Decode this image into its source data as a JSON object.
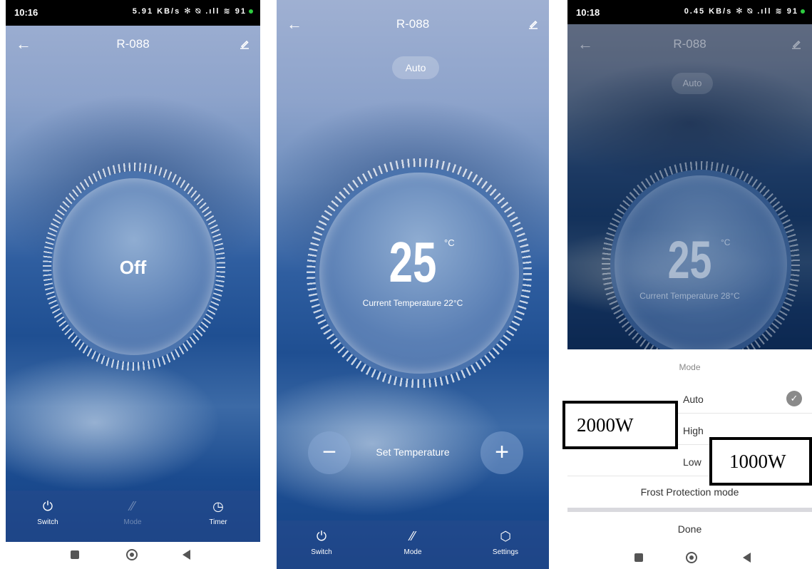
{
  "panel1": {
    "status_time": "10:16",
    "status_icons": "5.91 KB/s ✻ ⍉ .ıll ≋ 91",
    "title": "R-088",
    "dial_text": "Off",
    "tabs": [
      {
        "icon": "power-icon",
        "glyph": "⏻",
        "label": "Switch"
      },
      {
        "icon": "mode-icon",
        "glyph": "⁄⁄",
        "label": "Mode"
      },
      {
        "icon": "clock-icon",
        "glyph": "◷",
        "label": "Timer"
      }
    ]
  },
  "panel2": {
    "title": "R-088",
    "mode_chip": "Auto",
    "set_temp": "25",
    "unit": "°C",
    "current_temp": "Current Temperature 22°C",
    "set_label": "Set Temperature",
    "minus": "−",
    "plus": "+",
    "tabs": [
      {
        "icon": "power-icon",
        "glyph": "⏻",
        "label": "Switch"
      },
      {
        "icon": "mode-icon",
        "glyph": "⁄⁄",
        "label": "Mode"
      },
      {
        "icon": "settings-icon",
        "glyph": "⬡",
        "label": "Settings"
      }
    ]
  },
  "panel3": {
    "status_time": "10:18",
    "status_icons": "0.45 KB/s ✻ ⍉ .ıll ≋ 91",
    "title": "R-088",
    "mode_chip": "Auto",
    "set_temp": "25",
    "unit": "°C",
    "current_temp": "Current Temperature 28°C",
    "sheet": {
      "heading": "Mode",
      "options": [
        {
          "label": "Auto",
          "selected": true
        },
        {
          "label": "High",
          "selected": false
        },
        {
          "label": "Low",
          "selected": false
        },
        {
          "label": "Frost Protection mode",
          "selected": false
        }
      ],
      "done": "Done"
    },
    "annotations": [
      "2000W",
      "1000W"
    ]
  },
  "colors": {
    "accent": "#1f4f92",
    "check": "#8a8a8a"
  }
}
